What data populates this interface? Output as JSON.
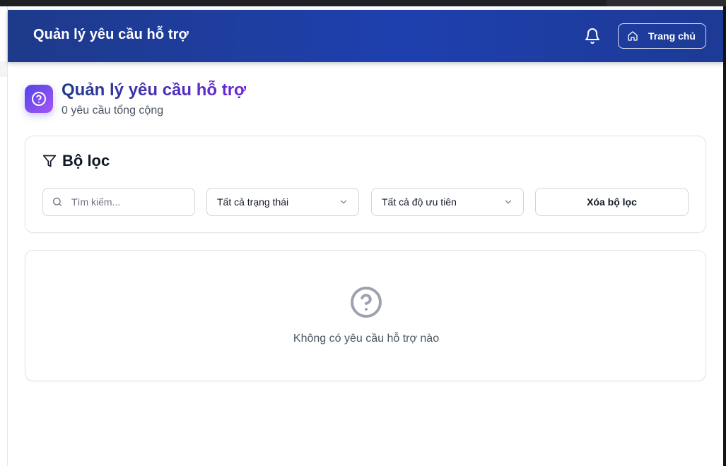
{
  "header": {
    "title": "Quản lý yêu cầu hỗ trợ",
    "home_label": "Trang chủ"
  },
  "page": {
    "title": "Quản lý yêu cầu hỗ trợ",
    "subtitle": "0 yêu cầu tổng cộng"
  },
  "filters": {
    "title": "Bộ lọc",
    "search_placeholder": "Tìm kiếm...",
    "search_value": "",
    "status_selected": "Tất cả trạng thái",
    "priority_selected": "Tất cả độ ưu tiên",
    "clear_label": "Xóa bộ lọc"
  },
  "empty_state": {
    "message": "Không có yêu cầu hỗ trợ nào"
  },
  "icons": {
    "header_bell": "bell-icon",
    "home": "home-icon",
    "page": "help-circle-icon",
    "filter": "filter-icon",
    "search": "search-icon",
    "chevron": "chevron-down-icon",
    "empty": "help-circle-icon"
  },
  "colors": {
    "header_start": "#1e3a8a",
    "header_end": "#1e40af",
    "accent_purple": "#6d28d9",
    "muted_text": "#4b5563",
    "border": "#e2e4e9"
  }
}
